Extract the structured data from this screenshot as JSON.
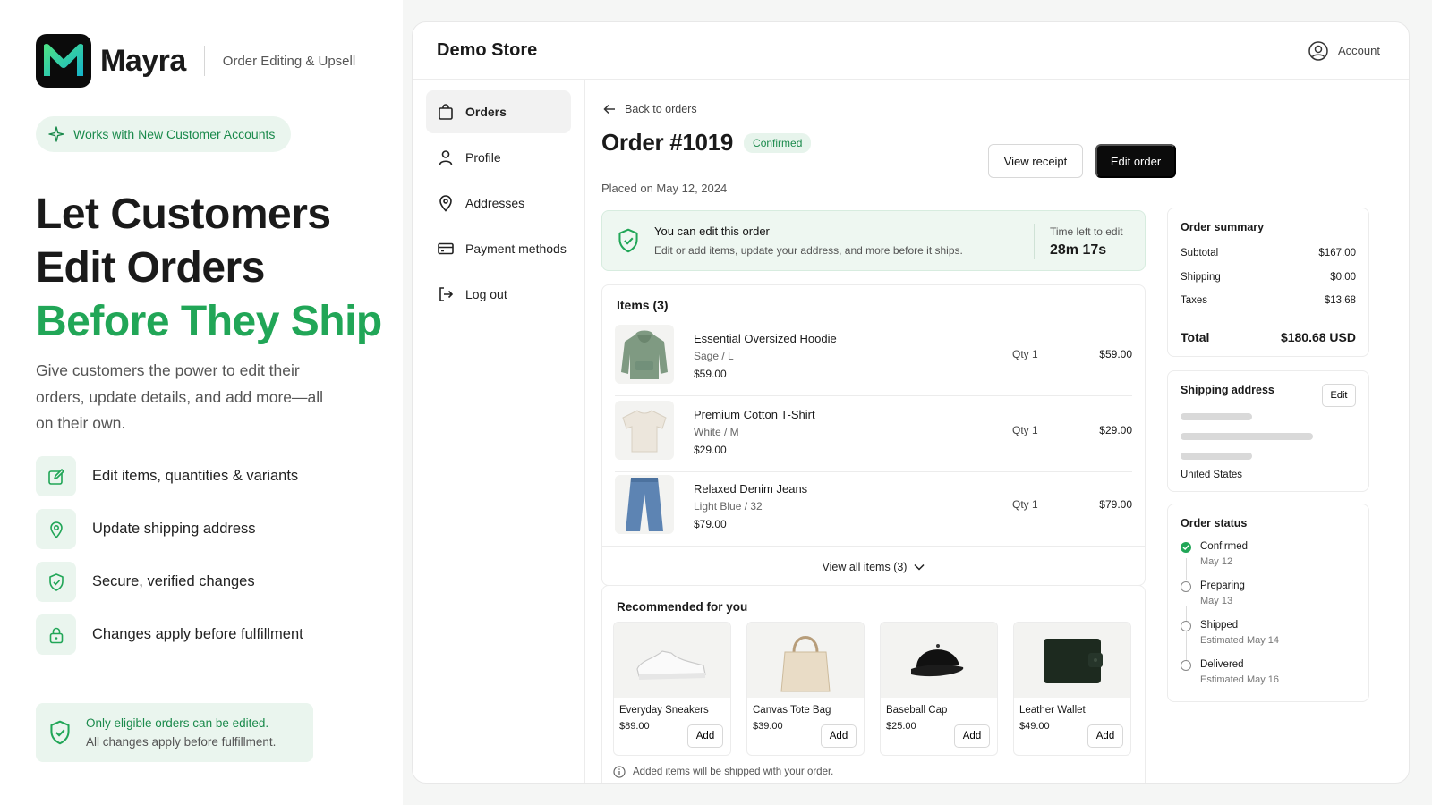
{
  "brand": {
    "name": "Mayra",
    "tagline": "Order Editing & Upsell"
  },
  "pill": "Works with New Customer Accounts",
  "hero": {
    "line1": "Let Customers",
    "line2": "Edit Orders",
    "line3": "Before They Ship"
  },
  "lead": "Give customers the power to edit their orders, update details, and add more—all on their own.",
  "features": [
    {
      "label": "Edit items, quantities & variants",
      "icon": "edit-icon"
    },
    {
      "label": "Update shipping address",
      "icon": "location-pin-icon"
    },
    {
      "label": "Secure, verified changes",
      "icon": "shield-check-icon"
    },
    {
      "label": "Changes apply before fulfillment",
      "icon": "lock-icon"
    }
  ],
  "note": {
    "line1": "Only eligible orders can be edited.",
    "line2": "All changes apply before fulfillment."
  },
  "app": {
    "store": "Demo Store",
    "account": "Account",
    "nav": [
      "Orders",
      "Profile",
      "Addresses",
      "Payment methods",
      "Log out"
    ],
    "back": "Back to orders",
    "order_title": "Order #1019",
    "status_badge": "Confirmed",
    "placed": "Placed on May 12, 2024",
    "view_receipt": "View receipt",
    "edit_order": "Edit order",
    "banner": {
      "title": "You can edit this order",
      "desc": "Edit or add items, update your address, and more before it ships.",
      "time_label": "Time left to edit",
      "time_value": "28m 17s"
    },
    "items_title": "Items (3)",
    "items": [
      {
        "name": "Essential Oversized Hoodie",
        "variant": "Sage / L",
        "price": "$59.00",
        "qty": "Qty 1",
        "amount": "$59.00"
      },
      {
        "name": "Premium Cotton T-Shirt",
        "variant": "White / M",
        "price": "$29.00",
        "qty": "Qty 1",
        "amount": "$29.00"
      },
      {
        "name": "Relaxed Denim Jeans",
        "variant": "Light Blue / 32",
        "price": "$79.00",
        "qty": "Qty 1",
        "amount": "$79.00"
      }
    ],
    "view_all": "View all items (3)",
    "rec_title": "Recommended for you",
    "rec": [
      {
        "name": "Everyday Sneakers",
        "price": "$89.00",
        "add": "Add"
      },
      {
        "name": "Canvas Tote Bag",
        "price": "$39.00",
        "add": "Add"
      },
      {
        "name": "Baseball Cap",
        "price": "$25.00",
        "add": "Add"
      },
      {
        "name": "Leather Wallet",
        "price": "$49.00",
        "add": "Add"
      }
    ],
    "rec_note": "Added items will be shipped with your order.",
    "summary": {
      "title": "Order summary",
      "subtotal_label": "Subtotal",
      "subtotal": "$167.00",
      "shipping_label": "Shipping",
      "shipping": "$0.00",
      "taxes_label": "Taxes",
      "taxes": "$13.68",
      "total_label": "Total",
      "total": "$180.68 USD"
    },
    "ship": {
      "title": "Shipping address",
      "edit": "Edit",
      "country": "United States"
    },
    "status": {
      "title": "Order status",
      "steps": [
        {
          "name": "Confirmed",
          "date": "May 12"
        },
        {
          "name": "Preparing",
          "date": "May 13"
        },
        {
          "name": "Shipped",
          "date": "Estimated May 14"
        },
        {
          "name": "Delivered",
          "date": "Estimated May 16"
        }
      ]
    }
  },
  "colors": {
    "accent": "#21a657",
    "accent_bg": "#eaf5ee",
    "dark": "#0b0b0b"
  }
}
